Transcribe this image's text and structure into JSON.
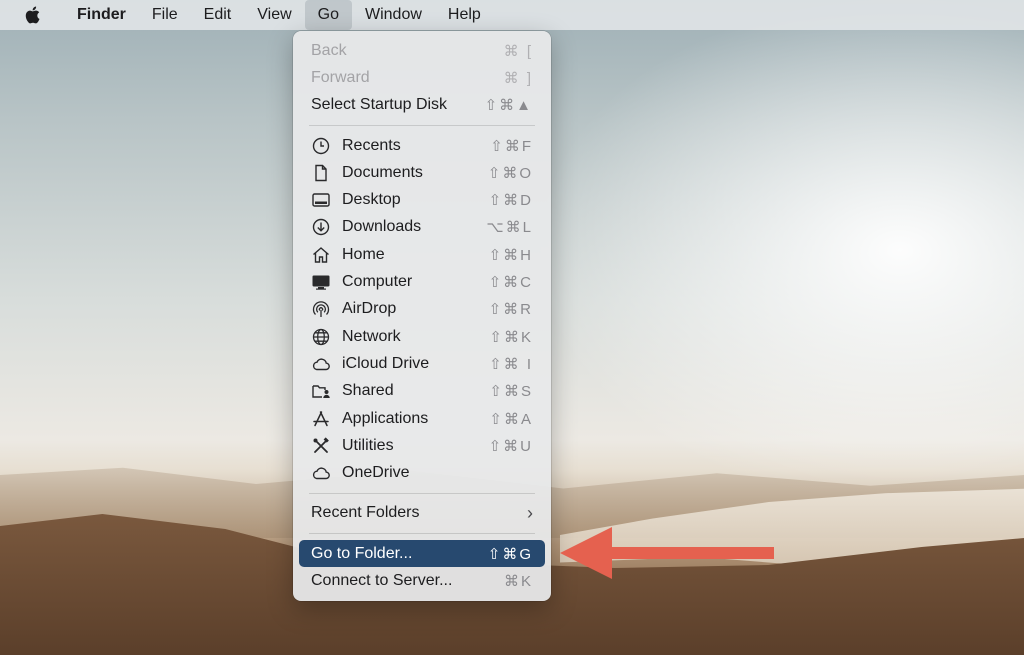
{
  "menubar": {
    "app": "Finder",
    "items": [
      "File",
      "Edit",
      "View",
      "Go",
      "Window",
      "Help"
    ],
    "active": "Go"
  },
  "go_menu": {
    "nav": [
      {
        "label": "Back",
        "shortcut": "⌘ [",
        "enabled": false
      },
      {
        "label": "Forward",
        "shortcut": "⌘ ]",
        "enabled": false
      },
      {
        "label": "Select Startup Disk",
        "shortcut": "⇧⌘▲",
        "enabled": true
      }
    ],
    "places": [
      {
        "label": "Recents",
        "shortcut": "⇧⌘F",
        "icon": "clock-icon"
      },
      {
        "label": "Documents",
        "shortcut": "⇧⌘O",
        "icon": "document-icon"
      },
      {
        "label": "Desktop",
        "shortcut": "⇧⌘D",
        "icon": "desktop-icon"
      },
      {
        "label": "Downloads",
        "shortcut": "⌥⌘L",
        "icon": "download-icon"
      },
      {
        "label": "Home",
        "shortcut": "⇧⌘H",
        "icon": "home-icon"
      },
      {
        "label": "Computer",
        "shortcut": "⇧⌘C",
        "icon": "computer-icon"
      },
      {
        "label": "AirDrop",
        "shortcut": "⇧⌘R",
        "icon": "airdrop-icon"
      },
      {
        "label": "Network",
        "shortcut": "⇧⌘K",
        "icon": "globe-icon"
      },
      {
        "label": "iCloud Drive",
        "shortcut": "⇧⌘ I",
        "icon": "cloud-icon"
      },
      {
        "label": "Shared",
        "shortcut": "⇧⌘S",
        "icon": "shared-folder-icon"
      },
      {
        "label": "Applications",
        "shortcut": "⇧⌘A",
        "icon": "applications-icon"
      },
      {
        "label": "Utilities",
        "shortcut": "⇧⌘U",
        "icon": "utilities-icon"
      },
      {
        "label": "OneDrive",
        "shortcut": "",
        "icon": "cloud-icon"
      }
    ],
    "recent_folders": {
      "label": "Recent Folders",
      "submenu_icon": "chevron-right-icon"
    },
    "folder_actions": [
      {
        "label": "Go to Folder...",
        "shortcut": "⇧⌘G",
        "highlighted": true
      },
      {
        "label": "Connect to Server...",
        "shortcut": "⌘K",
        "highlighted": false
      }
    ]
  },
  "colors": {
    "highlight": "#27496f",
    "arrow": "#e5614f"
  }
}
